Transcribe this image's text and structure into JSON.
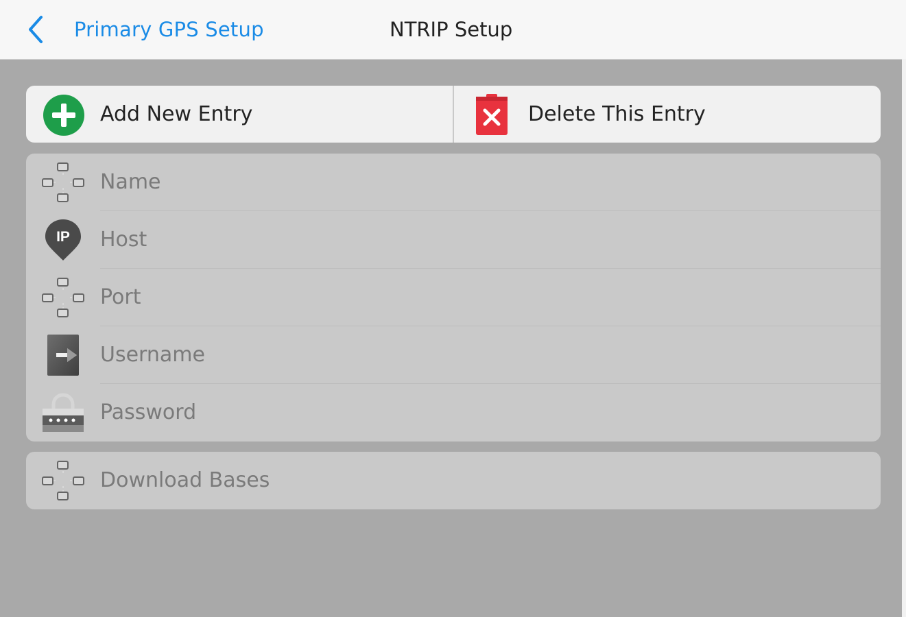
{
  "header": {
    "back_label": "Primary GPS Setup",
    "title": "NTRIP Setup",
    "accent_color": "#1a8be6"
  },
  "actions": {
    "add_label": "Add New Entry",
    "delete_label": "Delete This Entry",
    "add_icon": "plus-circle-icon",
    "delete_icon": "trash-x-icon",
    "add_color": "#1e9e4a",
    "delete_color": "#e8323e"
  },
  "fields": [
    {
      "label": "Name",
      "icon": "network-nodes-icon"
    },
    {
      "label": "Host",
      "icon": "ip-pin-icon"
    },
    {
      "label": "Port",
      "icon": "network-nodes-icon"
    },
    {
      "label": "Username",
      "icon": "login-door-icon"
    },
    {
      "label": "Password",
      "icon": "password-lock-icon"
    }
  ],
  "download": {
    "label": "Download Bases",
    "icon": "network-nodes-icon"
  }
}
